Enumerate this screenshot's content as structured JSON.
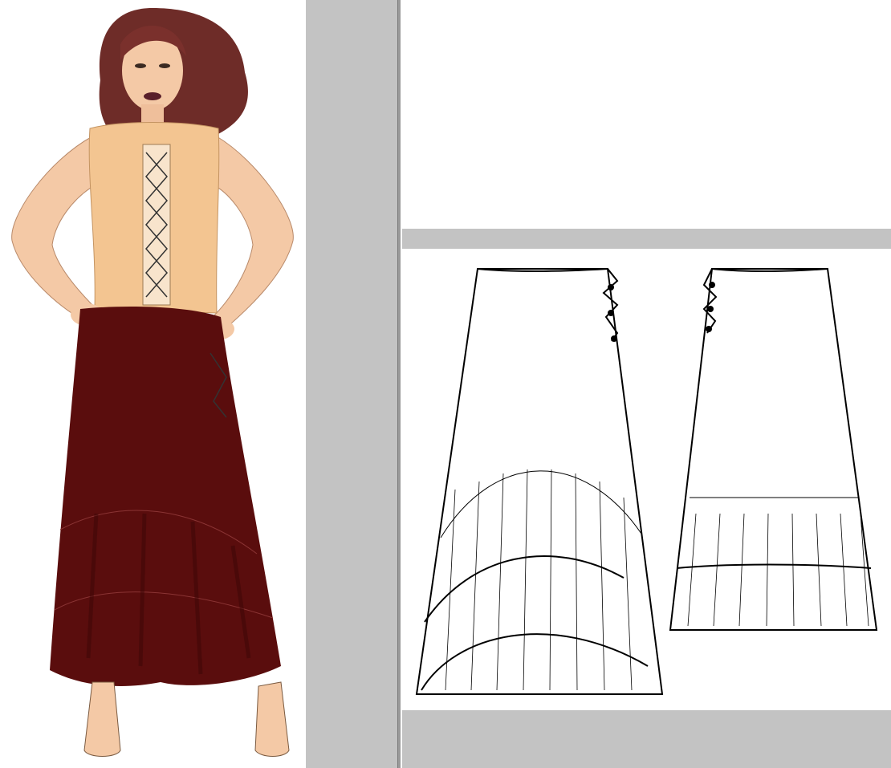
{
  "layout_regions": {
    "model_panel": "fashion-illustration",
    "flats_panel": "technical-flats"
  },
  "top_caption": "",
  "colors": {
    "bodice": "#f3c591",
    "skirt": "#5a0d0d",
    "skirt_shadow": "#3c0707",
    "hair": "#6e2c28",
    "skin": "#f4c9a6",
    "panel_gray": "#c3c3c3",
    "line": "#000000"
  },
  "icons": {
    "garment_front": "skirt-front-flat-icon",
    "garment_back": "skirt-back-flat-icon"
  }
}
